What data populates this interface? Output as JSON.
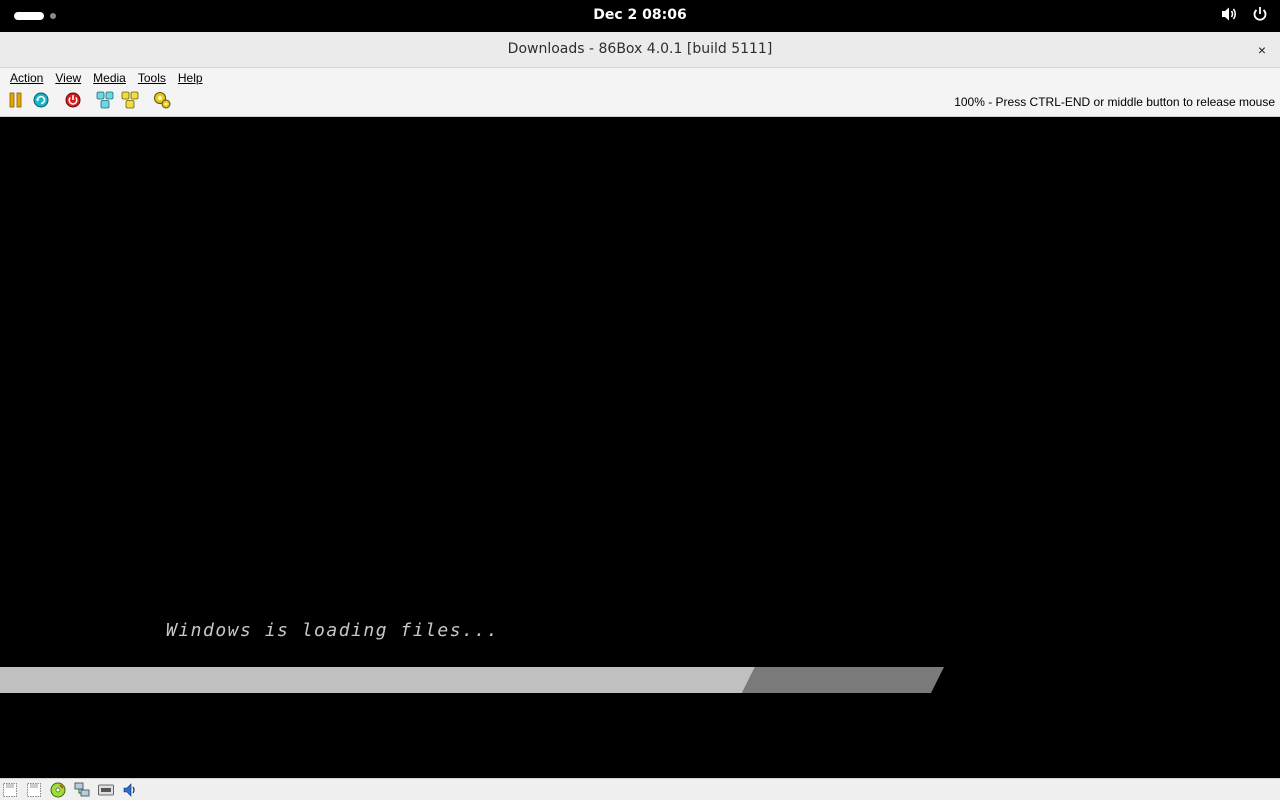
{
  "topbar": {
    "clock": "Dec 2  08:06",
    "icons": [
      "activities-indicator",
      "volume-icon",
      "power-icon"
    ]
  },
  "window": {
    "title": "Downloads - 86Box 4.0.1 [build 5111]",
    "close_icon": "×"
  },
  "menu": {
    "items": [
      "Action",
      "View",
      "Media",
      "Tools",
      "Help"
    ]
  },
  "toolbar": {
    "buttons": [
      "pause-icon",
      "hard-reset-icon",
      "power-off-icon",
      "ctrl-alt-del-icon",
      "ctrl-alt-esc-icon",
      "settings-icon"
    ],
    "status": "100% - Press CTRL-END or middle button to release mouse"
  },
  "screen": {
    "loading_text": "Windows is loading files...",
    "progress_fraction": 0.8,
    "colors": {
      "bar": "#c0c0c0",
      "indicator": "#7a7a7a",
      "background": "#000000"
    }
  },
  "statusbar": {
    "icons": [
      "floppy-a-icon",
      "floppy-b-icon",
      "cdrom-icon",
      "network-icon",
      "hdd-icon",
      "sound-icon"
    ]
  }
}
